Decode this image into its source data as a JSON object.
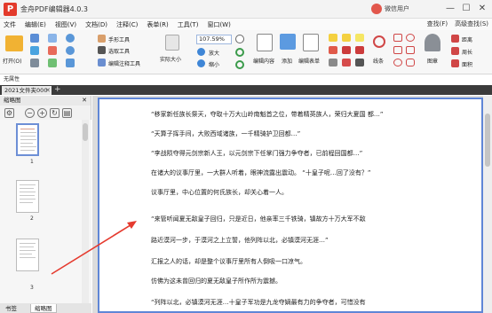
{
  "app": {
    "title": "金舟PDF编辑器4.0.3",
    "logo_char": "P",
    "user_name": "微信用户",
    "win": {
      "minimize": "—",
      "maximize": "☐",
      "close": "✕"
    }
  },
  "menu": {
    "items": [
      "文件",
      "编辑(E)",
      "视图(V)",
      "文档(D)",
      "注释(C)",
      "表单(R)",
      "工具(T)",
      "窗口(W)"
    ],
    "right": [
      "查找(F)",
      "高级查找(S)"
    ]
  },
  "ribbon": {
    "open_label": "打开(O)",
    "hand_tool": "手形工具",
    "select_tool": "选取工具",
    "edit_annot_tool": "编辑注释工具",
    "actual_size": "实际大小",
    "zoom_value": "107.59%",
    "zoom_in": "放大",
    "zoom_out": "缩小",
    "edit_content": "编辑内容",
    "add": "添加",
    "edit_form": "编辑表单",
    "line": "线条",
    "stamp": "图章",
    "distance": "距离",
    "perimeter": "周长",
    "area": "面积",
    "subtitle": "无属性"
  },
  "tabs": {
    "doc_tab": "2021文件夹000",
    "add": "+"
  },
  "panel": {
    "title": "缩略图",
    "close": "✕",
    "thumbnails": [
      {
        "num": "1"
      },
      {
        "num": "2"
      },
      {
        "num": "3"
      }
    ],
    "tabs": [
      "书签",
      "缩略图"
    ]
  },
  "document": {
    "lines": [
      "“移家新任族长祭天，夺取十万大山岭南魁首之位，带着精英族人，荣归大夏国   都…”",
      "“天算子挥手间，大败西域诸族，一千精骑护卫回都…”",
      "“李战陨夺得元剑宗新人王，以元剑宗下任掌门强力争夺者，已前程回国都…”",
      "在诸大的议事厅里，一大群人听着，眼神流露出震动。          “十皇子呢…回了没有？”",
      "议事厅里，中心位置的何氏族长，却关心着一人。",
      "“来管听闻夏无敌皇子回归，只是近日，他亲率三千铁骑，镇故方十万大军不敌",
      "路近漠河一步，于漠河之上立誓，他列阵以北，必镇漠河无涯…”",
      "汇报之人的话，却是整个议事厅里所有人倒吸一口凉气。",
      "仿佛为这未曾回归的夏无敌皇子所作所为震撼。",
      "“列阵以北，必镇漠河无涯…十皇子军功是九龙夺嫡最有力的争夺者，可惜没有"
    ]
  }
}
